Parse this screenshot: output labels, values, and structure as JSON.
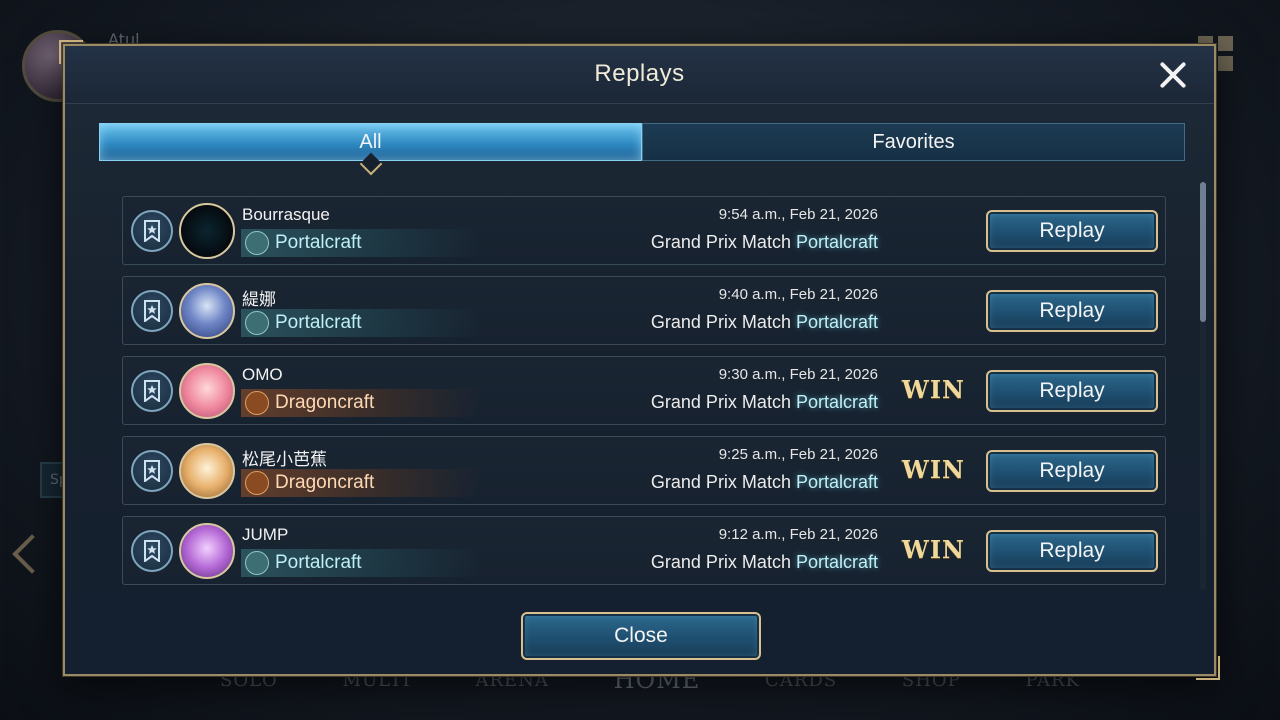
{
  "background": {
    "player_name": "Atul",
    "special_label": "Special",
    "nav": [
      "SOLO",
      "MULTI",
      "ARENA",
      "HOME",
      "CARDS",
      "SHOP",
      "PARK"
    ],
    "nav_active": "HOME"
  },
  "modal": {
    "title": "Replays",
    "close_icon": "close-x-icon",
    "close_button_label": "Close"
  },
  "tabs": [
    {
      "label": "All",
      "active": true
    },
    {
      "label": "Favorites",
      "active": false
    }
  ],
  "replays": [
    {
      "player": "Bourrasque",
      "class": "Portalcraft",
      "class_type": "portal",
      "time": "9:54 a.m., Feb 21, 2026",
      "match_type": "Grand Prix Match",
      "my_class": "Portalcraft",
      "result": "",
      "button": "Replay"
    },
    {
      "player": "緹娜",
      "class": "Portalcraft",
      "class_type": "portal",
      "time": "9:40 a.m., Feb 21, 2026",
      "match_type": "Grand Prix Match",
      "my_class": "Portalcraft",
      "result": "",
      "button": "Replay"
    },
    {
      "player": "OMO",
      "class": "Dragoncraft",
      "class_type": "dragon",
      "time": "9:30 a.m., Feb 21, 2026",
      "match_type": "Grand Prix Match",
      "my_class": "Portalcraft",
      "result": "WIN",
      "button": "Replay"
    },
    {
      "player": "松尾小芭蕉",
      "class": "Dragoncraft",
      "class_type": "dragon",
      "time": "9:25 a.m., Feb 21, 2026",
      "match_type": "Grand Prix Match",
      "my_class": "Portalcraft",
      "result": "WIN",
      "button": "Replay"
    },
    {
      "player": "JUMP",
      "class": "Portalcraft",
      "class_type": "portal",
      "time": "9:12 a.m., Feb 21, 2026",
      "match_type": "Grand Prix Match",
      "my_class": "Portalcraft",
      "result": "WIN",
      "button": "Replay"
    }
  ],
  "colors": {
    "accent_gold": "#d7c08e",
    "tab_active": "#2f8ac2",
    "portal": "#bff0f5",
    "dragon": "#ffd9b3",
    "win": "#f0d89a"
  }
}
